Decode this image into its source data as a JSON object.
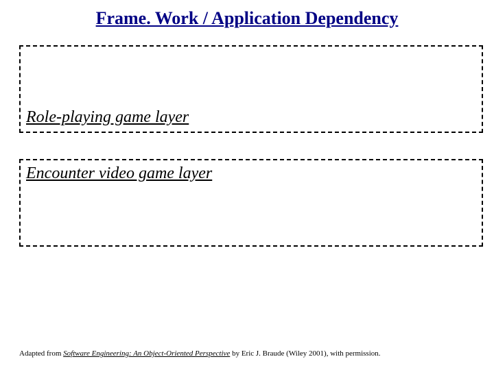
{
  "title": "Frame. Work / Application Dependency",
  "layers": {
    "top_label": "Role-playing game layer",
    "bottom_label": "Encounter video game layer"
  },
  "citation": {
    "prefix": "Adapted from ",
    "book": "Software Engineering: An Object-Oriented Perspective",
    "suffix": " by Eric J. Braude (Wiley 2001), with permission."
  }
}
